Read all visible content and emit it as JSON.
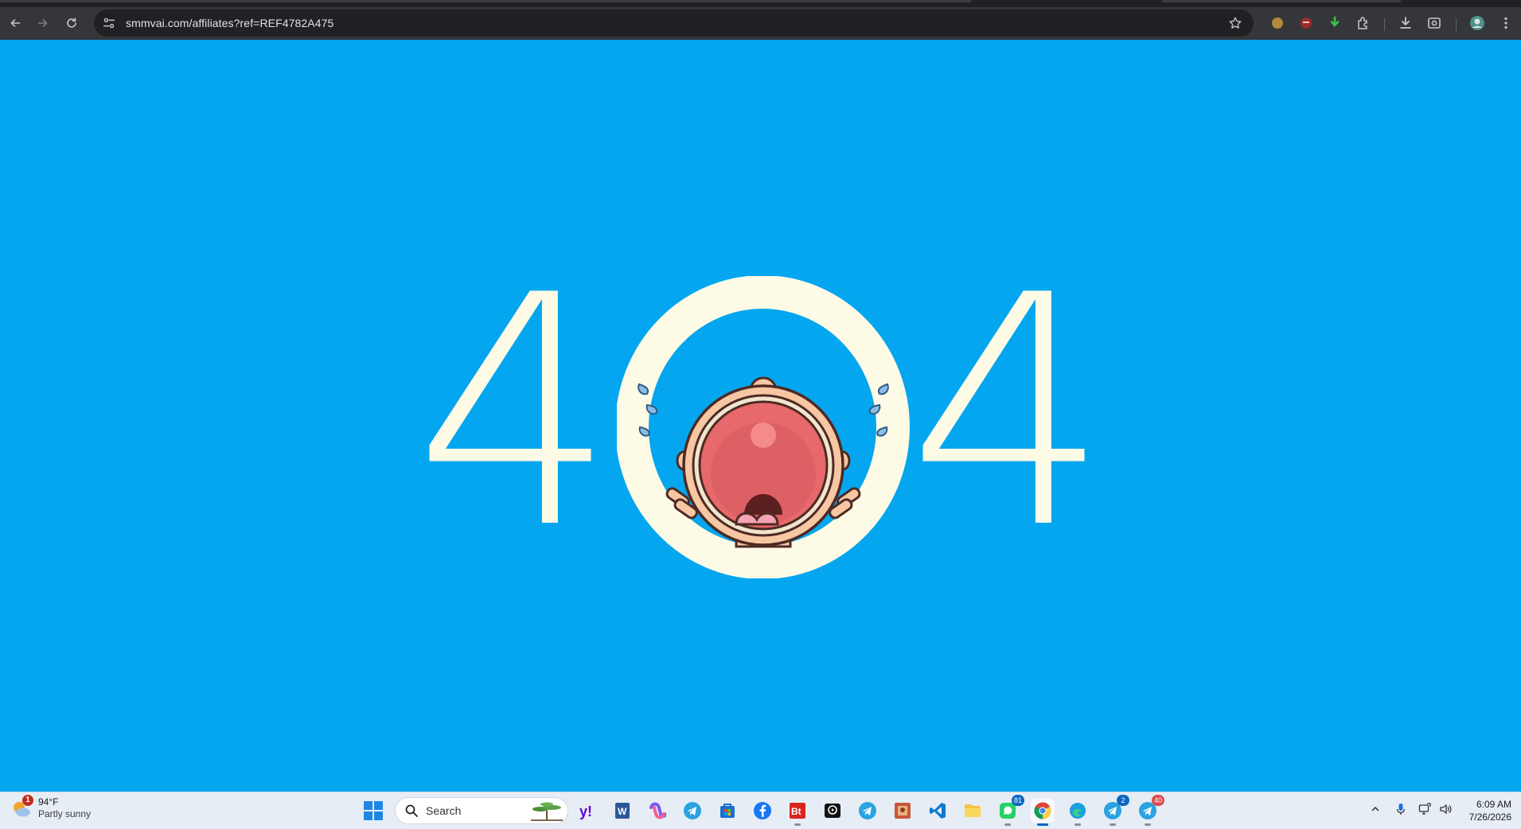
{
  "browser": {
    "url": "smmvai.com/affiliates?ref=REF4782A475"
  },
  "page": {
    "digit_left": "4",
    "digit_right": "4",
    "colors": {
      "background": "#05a6f0",
      "digits": "#fdfbe6",
      "mouth": "#e8696b"
    }
  },
  "taskbar": {
    "weather": {
      "temp": "94°F",
      "condition": "Partly sunny",
      "alert_count": "1"
    },
    "search_label": "Search",
    "badges": {
      "whatsapp": "81",
      "telegram": "2",
      "app_last": "40"
    },
    "clock": {
      "time": "6:09 AM",
      "date": "7/26/2026"
    }
  }
}
